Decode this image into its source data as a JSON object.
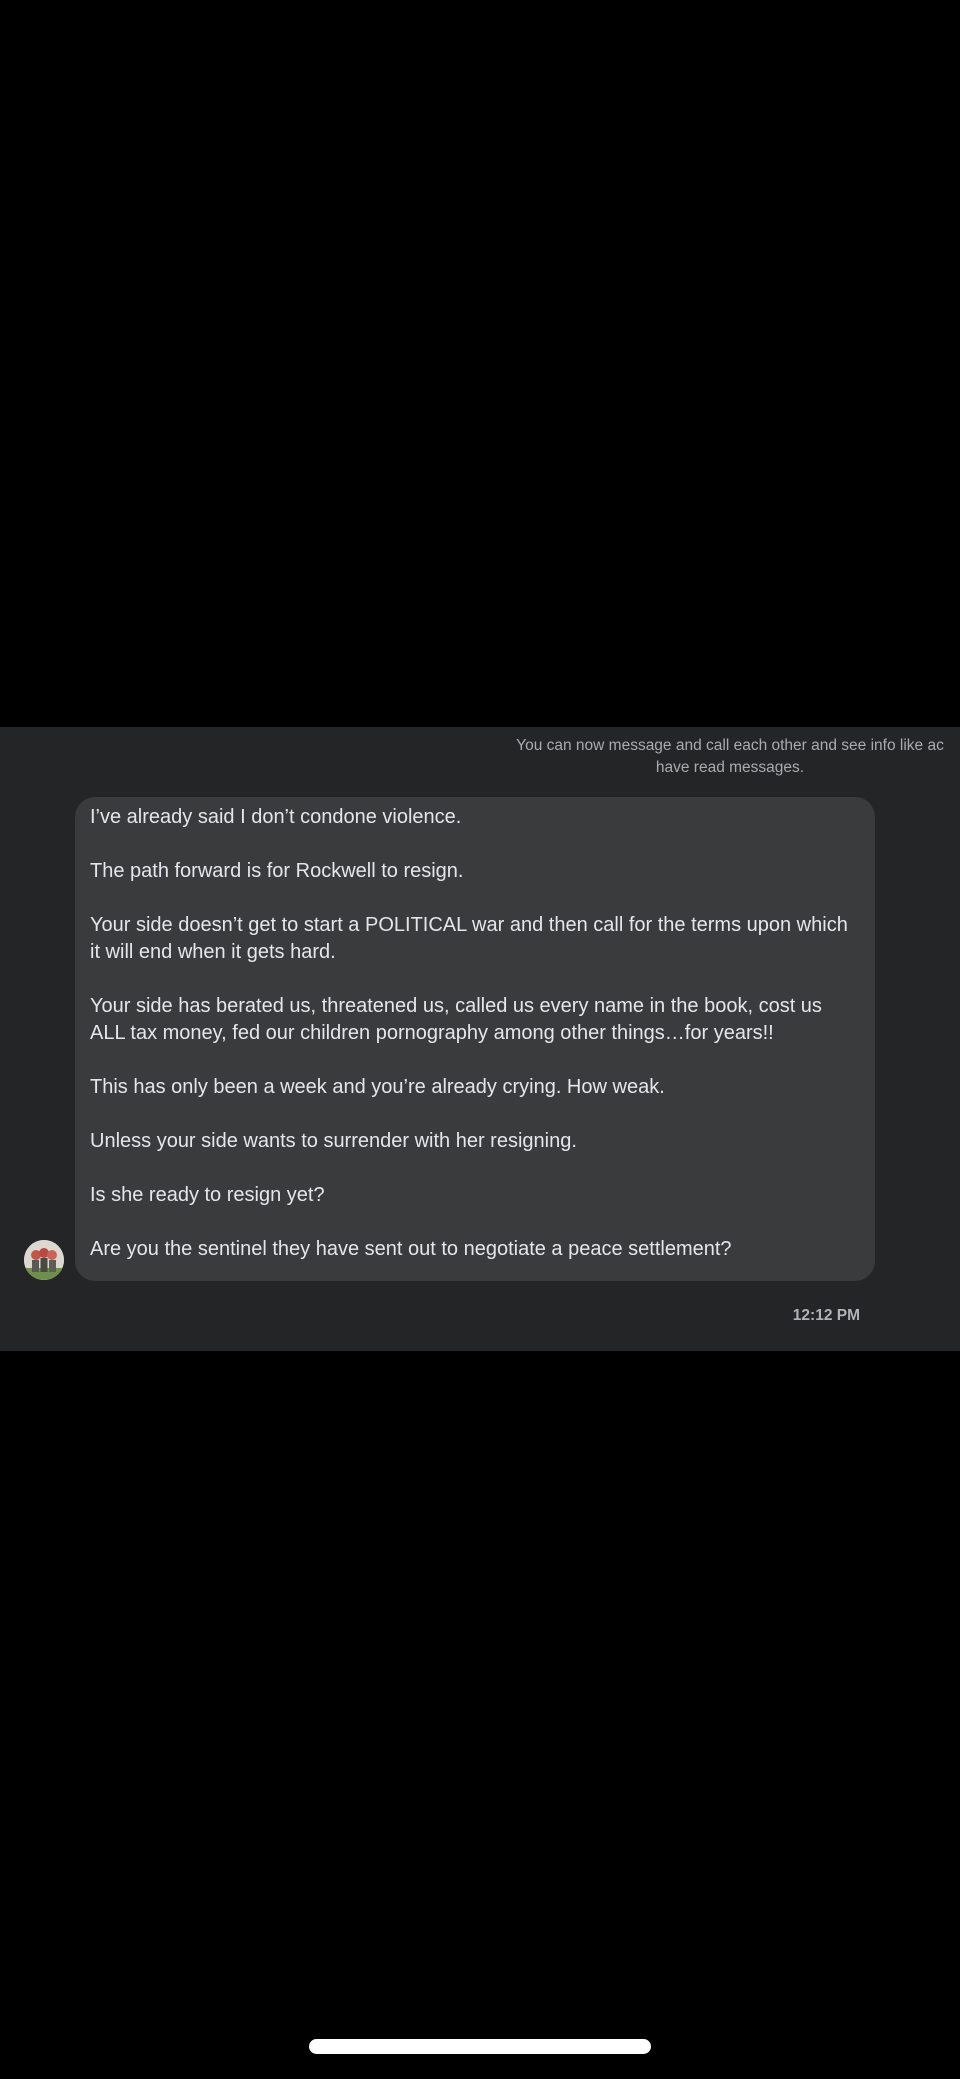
{
  "notice": {
    "line1": "You can now message and call each other and see info like ac",
    "line2": "have read messages."
  },
  "message": {
    "paragraphs": [
      "I’ve already said I don’t condone violence.",
      "The path forward is for Rockwell to resign.",
      "Your side doesn’t get to start a POLITICAL war and then call for the terms upon which it will end when it gets hard.",
      "Your side has berated us, threatened us, called us every name in the book, cost us ALL tax money, fed our children pornography among other things…for years!!",
      "This has only been a week and you’re already crying.  How weak.",
      "Unless your side wants to surrender with her resigning.",
      "Is she ready to resign yet?",
      "Are you the sentinel they have sent out to negotiate a peace settlement?"
    ],
    "timestamp": "12:12 PM"
  },
  "colors": {
    "background": "#000000",
    "panel": "#242526",
    "bubble": "#3a3b3c",
    "text": "#e4e6eb",
    "muted": "#b0b3b8"
  }
}
